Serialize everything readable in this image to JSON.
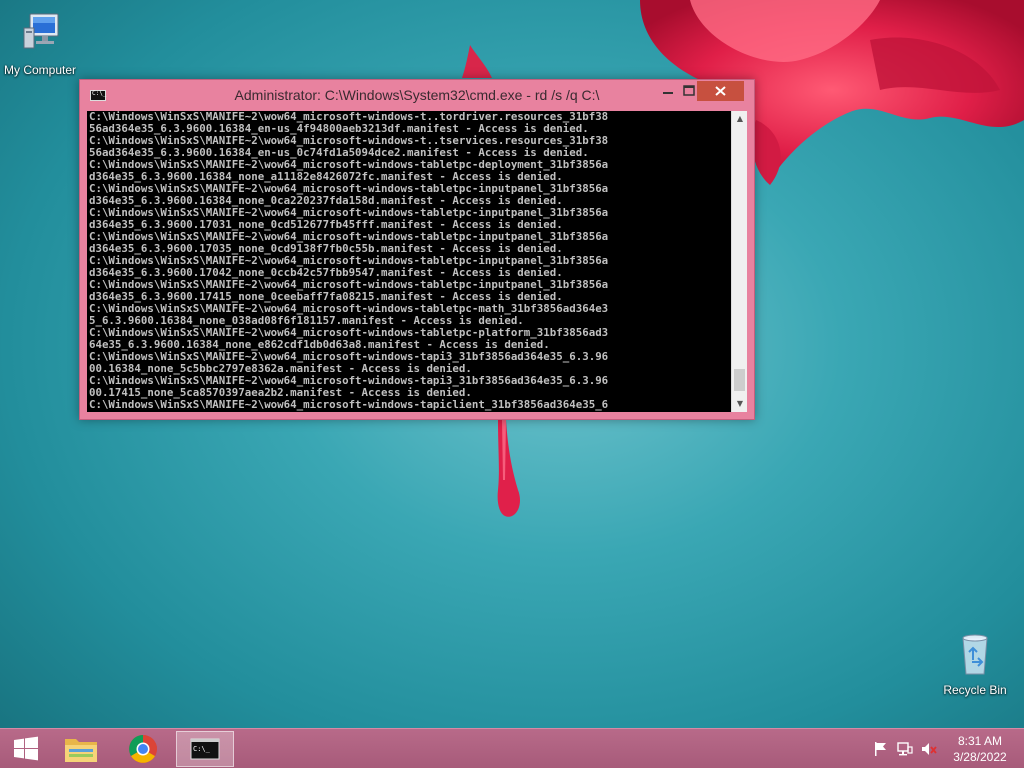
{
  "desktop": {
    "icons": [
      {
        "label": "My Computer",
        "icon": "computer-icon"
      },
      {
        "label": "Recycle Bin",
        "icon": "recycle-bin-icon"
      }
    ]
  },
  "cmd_window": {
    "title": "Administrator: C:\\Windows\\System32\\cmd.exe - rd  /s /q C:\\",
    "app_icon_text": "C:\\_",
    "buttons": {
      "minimize": "minimize",
      "maximize": "maximize",
      "close": "close"
    },
    "console_lines": [
      "C:\\Windows\\WinSxS\\MANIFE~2\\wow64_microsoft-windows-t..tordriver.resources_31bf38",
      "56ad364e35_6.3.9600.16384_en-us_4f94800aeb3213df.manifest - Access is denied.",
      "C:\\Windows\\WinSxS\\MANIFE~2\\wow64_microsoft-windows-t..tservices.resources_31bf38",
      "56ad364e35_6.3.9600.16384_en-us_0c74fd1a5094dce2.manifest - Access is denied.",
      "C:\\Windows\\WinSxS\\MANIFE~2\\wow64_microsoft-windows-tabletpc-deployment_31bf3856a",
      "d364e35_6.3.9600.16384_none_a11182e8426072fc.manifest - Access is denied.",
      "C:\\Windows\\WinSxS\\MANIFE~2\\wow64_microsoft-windows-tabletpc-inputpanel_31bf3856a",
      "d364e35_6.3.9600.16384_none_0ca220237fda158d.manifest - Access is denied.",
      "C:\\Windows\\WinSxS\\MANIFE~2\\wow64_microsoft-windows-tabletpc-inputpanel_31bf3856a",
      "d364e35_6.3.9600.17031_none_0cd512677fb45fff.manifest - Access is denied.",
      "C:\\Windows\\WinSxS\\MANIFE~2\\wow64_microsoft-windows-tabletpc-inputpanel_31bf3856a",
      "d364e35_6.3.9600.17035_none_0cd9138f7fb0c55b.manifest - Access is denied.",
      "C:\\Windows\\WinSxS\\MANIFE~2\\wow64_microsoft-windows-tabletpc-inputpanel_31bf3856a",
      "d364e35_6.3.9600.17042_none_0ccb42c57fbb9547.manifest - Access is denied.",
      "C:\\Windows\\WinSxS\\MANIFE~2\\wow64_microsoft-windows-tabletpc-inputpanel_31bf3856a",
      "d364e35_6.3.9600.17415_none_0ceebaff7fa08215.manifest - Access is denied.",
      "C:\\Windows\\WinSxS\\MANIFE~2\\wow64_microsoft-windows-tabletpc-math_31bf3856ad364e3",
      "5_6.3.9600.16384_none_038ad08f6f181157.manifest - Access is denied.",
      "C:\\Windows\\WinSxS\\MANIFE~2\\wow64_microsoft-windows-tabletpc-platform_31bf3856ad3",
      "64e35_6.3.9600.16384_none_e862cdf1db0d63a8.manifest - Access is denied.",
      "C:\\Windows\\WinSxS\\MANIFE~2\\wow64_microsoft-windows-tapi3_31bf3856ad364e35_6.3.96",
      "00.16384_none_5c5bbc2797e8362a.manifest - Access is denied.",
      "C:\\Windows\\WinSxS\\MANIFE~2\\wow64_microsoft-windows-tapi3_31bf3856ad364e35_6.3.96",
      "00.17415_none_5ca8570397aea2b2.manifest - Access is denied.",
      "C:\\Windows\\WinSxS\\MANIFE~2\\wow64_microsoft-windows-tapiclient_31bf3856ad364e35_6"
    ]
  },
  "taskbar": {
    "items": [
      {
        "name": "start",
        "icon": "windows-logo-icon"
      },
      {
        "name": "file-explorer",
        "icon": "folder-icon"
      },
      {
        "name": "chrome",
        "icon": "chrome-icon"
      },
      {
        "name": "command-prompt",
        "icon": "cmd-icon",
        "text": "C:\\_"
      }
    ],
    "tray_icons": [
      "flag-icon",
      "network-icon",
      "volume-muted-icon"
    ],
    "time": "8:31 AM",
    "date": "3/28/2022"
  },
  "colors": {
    "window_frame": "#e8829f",
    "close_button": "#c7503f",
    "taskbar": "#b0637f",
    "console_text": "#c0c0c0",
    "flower": "#e0204a"
  }
}
